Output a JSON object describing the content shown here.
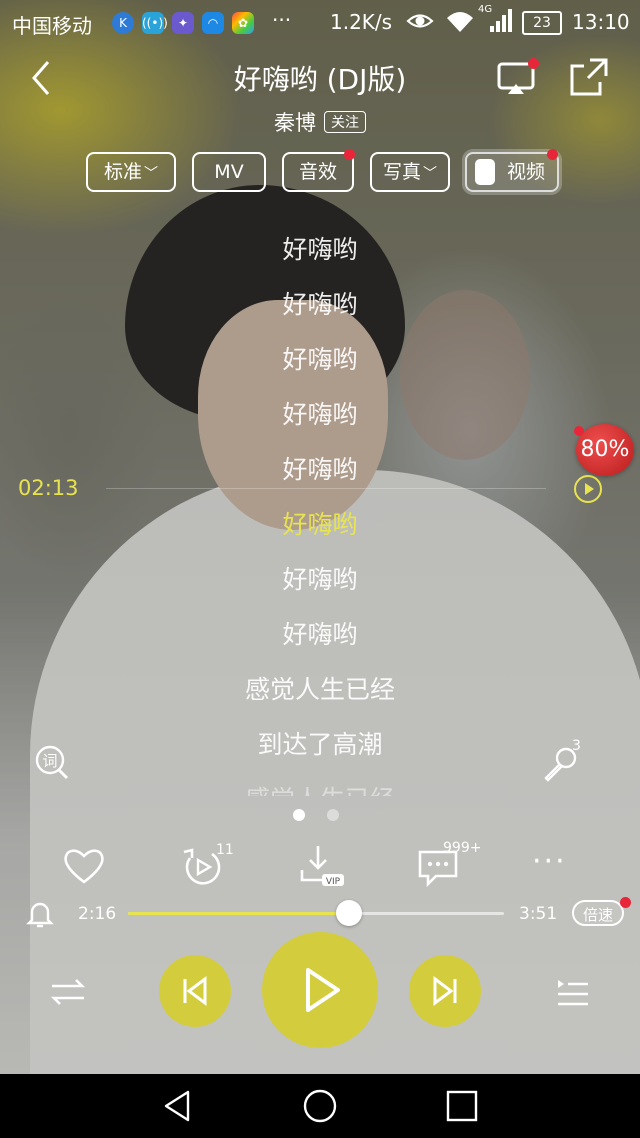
{
  "status_bar": {
    "carrier": "中国移动",
    "icons": [
      "k-app-icon",
      "signal-app-icon",
      "game-app-icon",
      "browser-app-icon",
      "photo-app-icon"
    ],
    "more": "···",
    "net_speed": "1.2K/s",
    "network_type": "4G",
    "battery": "23",
    "time": "13:10"
  },
  "header": {
    "title": "好嗨哟 (DJ版)",
    "artist": "秦博",
    "follow_label": "关注"
  },
  "chips": {
    "quality": "标准",
    "mv": "MV",
    "effects": "音效",
    "photos": "写真",
    "video": "视频"
  },
  "lyrics": {
    "lines": [
      "好嗨哟",
      "好嗨哟",
      "好嗨哟",
      "好嗨哟",
      "好嗨哟",
      "好嗨哟",
      "好嗨哟",
      "好嗨哟",
      "感觉人生已经",
      "到达了高潮",
      "感觉人生已经"
    ],
    "active_index": 5,
    "seek_time": "02:13"
  },
  "badge_percent": "80%",
  "mic_count": "3",
  "actions": {
    "like_icon": "heart-icon",
    "repeat_count": "11",
    "download_tag": "VIP",
    "comments_count": "999+",
    "more": "···"
  },
  "progress": {
    "current": "2:16",
    "total": "3:51",
    "fraction": 0.589,
    "speed_label": "倍速"
  },
  "colors": {
    "accent": "#d3cd3d",
    "lyric_active": "#e8e44f",
    "badge_red": "#e8263a"
  }
}
